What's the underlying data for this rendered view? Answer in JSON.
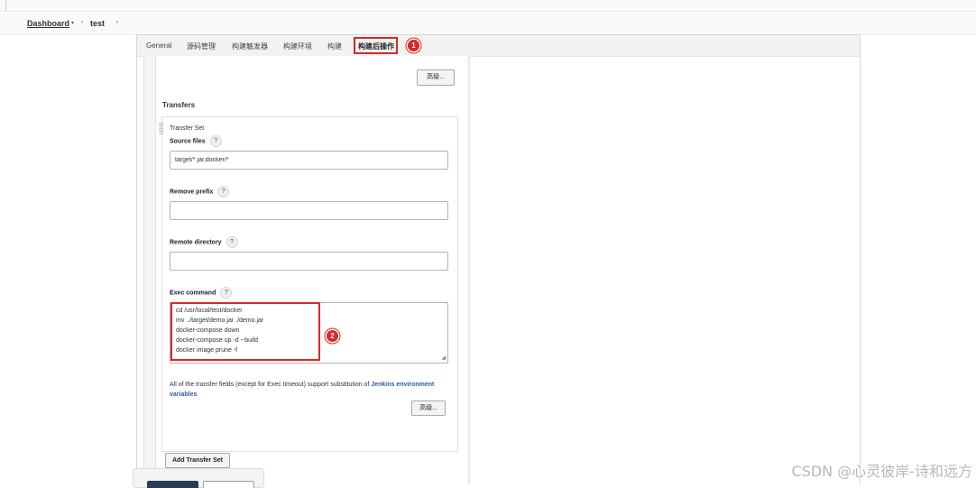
{
  "breadcrumb": {
    "dashboard": "Dashboard",
    "dashboard_caret": "▾",
    "separator": "›",
    "job": "test"
  },
  "tabs": [
    {
      "label": "General"
    },
    {
      "label": "源码管理"
    },
    {
      "label": "构建触发器"
    },
    {
      "label": "构建环境"
    },
    {
      "label": "构建"
    },
    {
      "label": "构建后操作",
      "active": true
    }
  ],
  "annotations": {
    "badge1": "1",
    "badge2": "2",
    "highlight_color": "#d42a2a"
  },
  "buttons": {
    "advanced_top": "高级...",
    "advanced_bottom": "高级...",
    "add_transfer_set": "Add Transfer Set"
  },
  "transfers": {
    "heading": "Transfers",
    "transfer_set_label": "Transfer Set",
    "source_files_label": "Source files",
    "source_files_value": "target/*.jar,docker/*",
    "remove_prefix_label": "Remove prefix",
    "remove_prefix_value": "",
    "remote_directory_label": "Remote directory",
    "remote_directory_value": "",
    "exec_command_label": "Exec command",
    "exec_command_lines": [
      "cd /usr/local/test/docker",
      "mv ../target/demo.jar ./demo.jar",
      "docker-compose down",
      "docker-compose up -d --build",
      "docker image prune -f"
    ],
    "help_glyph": "?",
    "hint_text": "All of the transfer fields (except for Exec timeout) support substitution of ",
    "hint_link": "Jenkins environment variables"
  },
  "watermark": "CSDN @心灵彼岸-诗和远方"
}
